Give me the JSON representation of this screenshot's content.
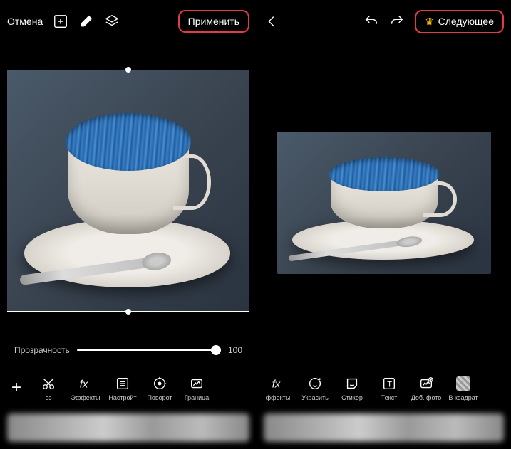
{
  "left": {
    "cancel": "Отмена",
    "apply": "Применить",
    "opacity_label": "Прозрачность",
    "opacity_value": "100",
    "tools": {
      "t0": "ез",
      "t1": "Эффекты",
      "t2": "Настройт",
      "t3": "Поворот",
      "t4": "Граница"
    }
  },
  "right": {
    "next": "Следующее",
    "tools": {
      "t0": "ффекты",
      "t1": "Украсить",
      "t2": "Стикер",
      "t3": "Текст",
      "t4": "Доб. фото",
      "t5": "В квадрат"
    }
  }
}
